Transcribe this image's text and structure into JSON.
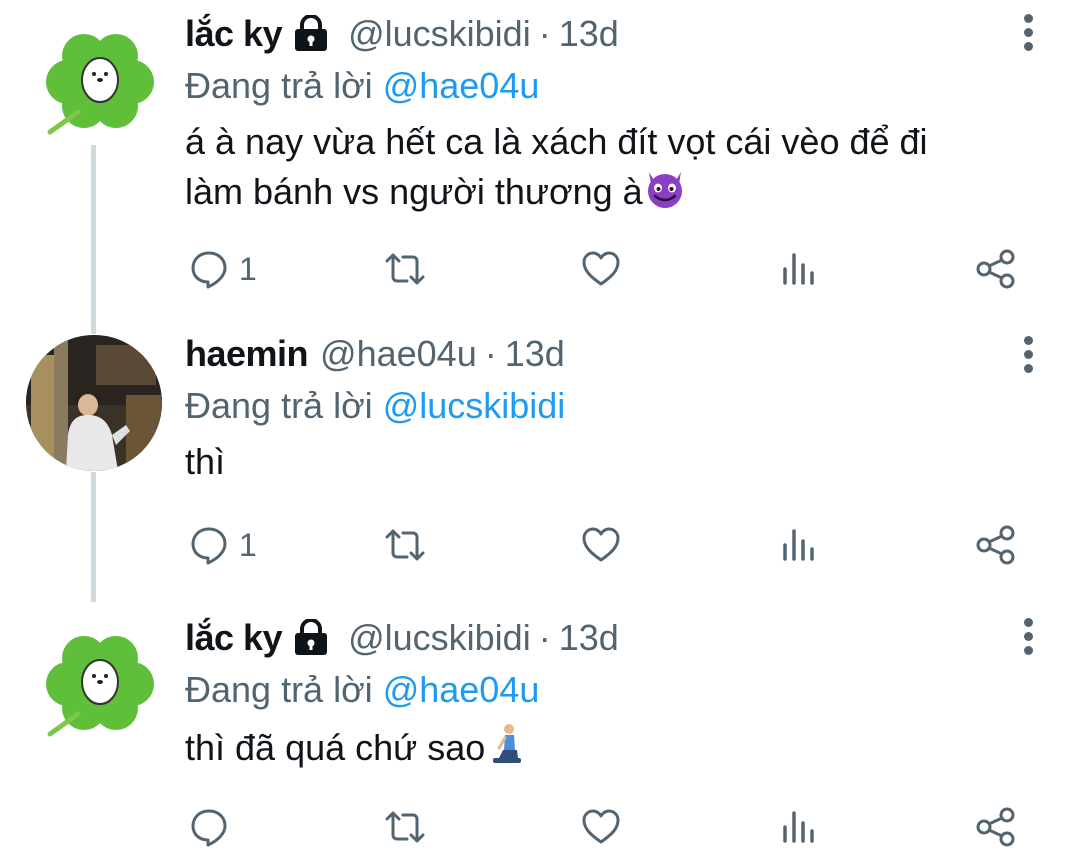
{
  "tweets": [
    {
      "name": "lắc ky",
      "locked": true,
      "handle": "@lucskibidi",
      "separator": "·",
      "time": "13d",
      "replying_prefix": "Đang trả lời ",
      "replying_to": "@hae04u",
      "text_line1": "á à nay vừa hết ca là xách đít vọt cái vèo để đi",
      "text_line2": "làm bánh vs người thương à",
      "emoji": "smiling-devil",
      "reply_count": "1"
    },
    {
      "name": "haemin",
      "locked": false,
      "handle": "@hae04u",
      "separator": "·",
      "time": "13d",
      "replying_prefix": "Đang trả lời ",
      "replying_to": "@lucskibidi",
      "text_line1": "thì",
      "reply_count": "1"
    },
    {
      "name": "lắc ky",
      "locked": true,
      "handle": "@lucskibidi",
      "separator": "·",
      "time": "13d",
      "replying_prefix": "Đang trả lời ",
      "replying_to": "@hae04u",
      "text_line1": "thì đã quá chứ sao",
      "emoji": "person-kneeling",
      "reply_count": ""
    }
  ],
  "colors": {
    "text": "#0f1419",
    "secondary": "#536471",
    "link": "#1d9bf0",
    "thread_line": "#cfd9de",
    "clover": "#5fbf3a"
  },
  "icons": [
    "reply-icon",
    "retweet-icon",
    "like-icon",
    "views-icon",
    "share-icon",
    "lock-icon",
    "more-icon"
  ]
}
